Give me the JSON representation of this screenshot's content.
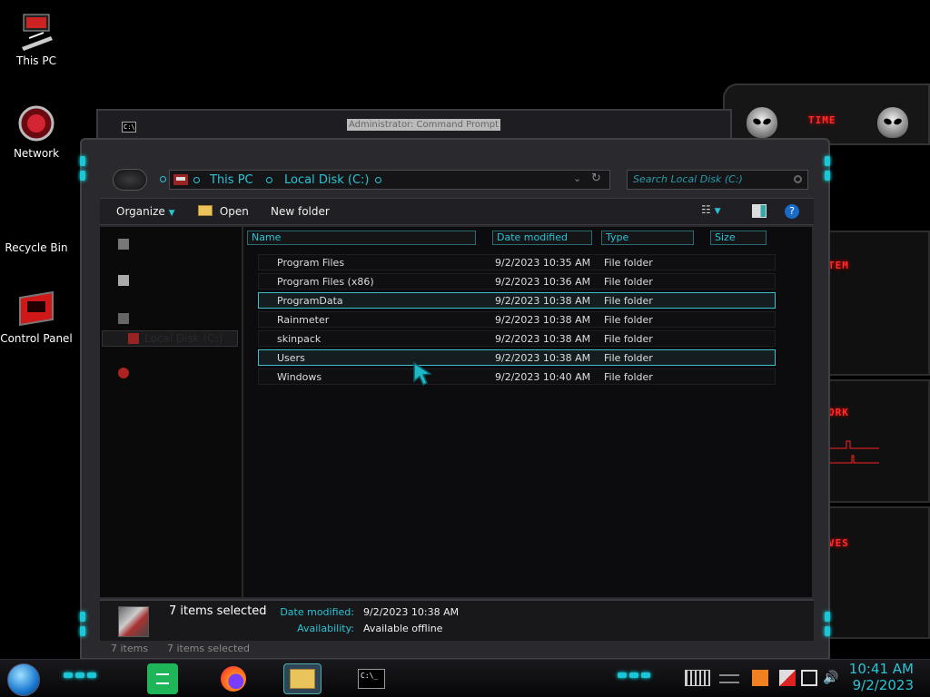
{
  "desktop": {
    "icons": [
      {
        "label": "This PC"
      },
      {
        "label": "Network"
      },
      {
        "label": "Recycle Bin"
      },
      {
        "label": "Control Panel"
      }
    ]
  },
  "gadgets": {
    "labels": [
      "TIME",
      "TEM",
      "ORK",
      "VES"
    ]
  },
  "cmd_window": {
    "title": "Administrator: Command Prompt",
    "icon_text": "C:\\"
  },
  "explorer": {
    "breadcrumbs": [
      "This PC",
      "Local Disk (C:)"
    ],
    "search_placeholder": "Search Local Disk (C:)",
    "toolbar": {
      "organize": "Organize",
      "open": "Open",
      "new_folder": "New folder"
    },
    "columns": [
      "Name",
      "Date modified",
      "Type",
      "Size"
    ],
    "nav_selected": "Local Disk (C:)",
    "rows": [
      {
        "name": "Program Files",
        "date": "9/2/2023 10:35 AM",
        "type": "File folder"
      },
      {
        "name": "Program Files (x86)",
        "date": "9/2/2023 10:36 AM",
        "type": "File folder"
      },
      {
        "name": "ProgramData",
        "date": "9/2/2023 10:38 AM",
        "type": "File folder"
      },
      {
        "name": "Rainmeter",
        "date": "9/2/2023 10:38 AM",
        "type": "File folder"
      },
      {
        "name": "skinpack",
        "date": "9/2/2023 10:38 AM",
        "type": "File folder"
      },
      {
        "name": "Users",
        "date": "9/2/2023 10:38 AM",
        "type": "File folder"
      },
      {
        "name": "Windows",
        "date": "9/2/2023 10:40 AM",
        "type": "File folder"
      }
    ],
    "details": {
      "count": "7 items selected",
      "date_key": "Date modified:",
      "date_val": "9/2/2023 10:38 AM",
      "avail_key": "Availability:",
      "avail_val": "Available offline"
    },
    "status": {
      "items": "7 items",
      "selected": "7 items selected"
    }
  },
  "taskbar": {
    "cmd_icon_text": "C:\\_",
    "time": "10:41 AM",
    "date": "9/2/2023"
  },
  "colors": {
    "accent_cyan": "#29c4d4",
    "alert_red": "#ff2a2a"
  }
}
